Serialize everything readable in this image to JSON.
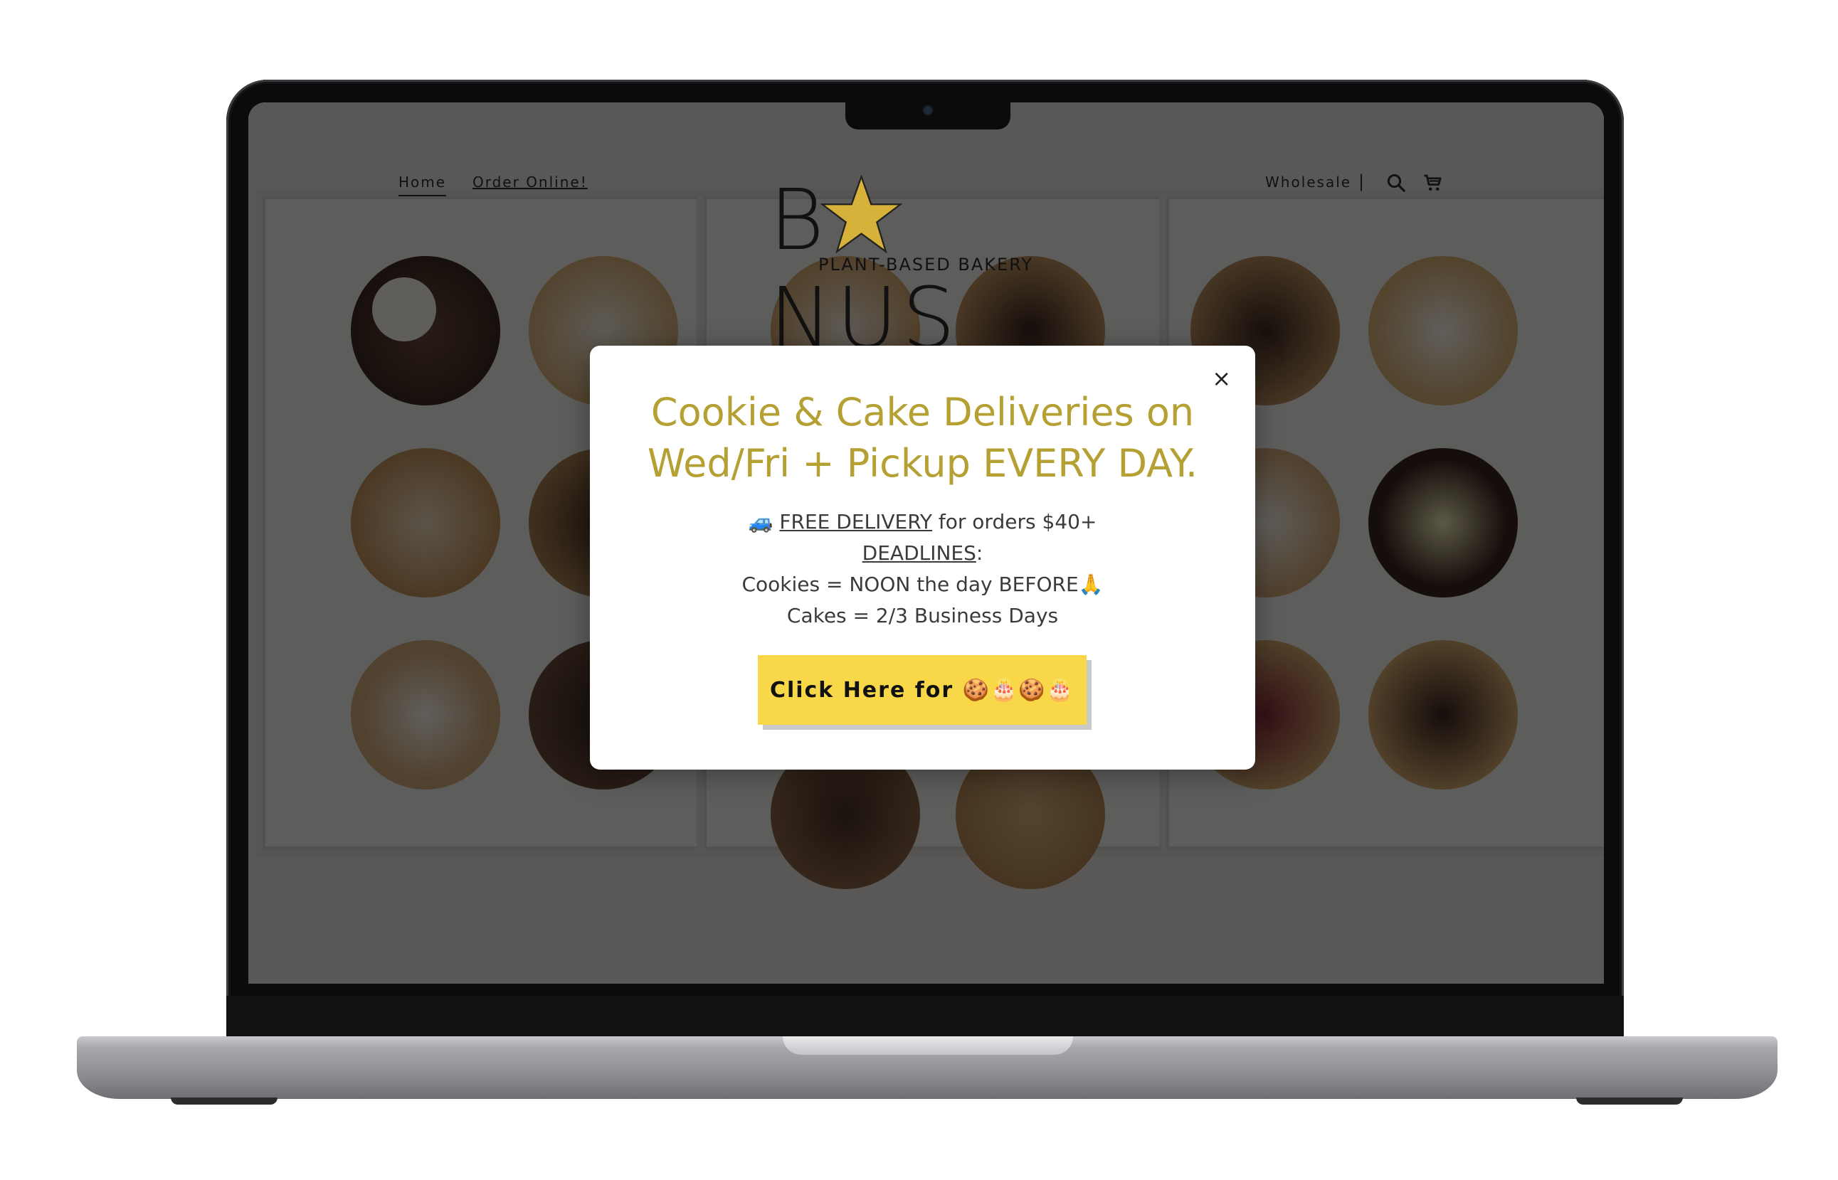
{
  "nav": {
    "home": "Home",
    "order_online": "Order Online!",
    "wholesale": "Wholesale",
    "divider": "|"
  },
  "logo": {
    "word_left": "B",
    "word_right": "NUS",
    "tagline": "PLANT-BASED BAKERY"
  },
  "modal": {
    "close": "×",
    "headline_line1": "Cookie & Cake Deliveries on",
    "headline_line2": "Wed/Fri + Pickup EVERY DAY.",
    "delivery_emoji": "🚙",
    "free_delivery": "FREE DELIVERY",
    "free_delivery_rest": " for orders $40+",
    "deadlines": "DEADLINES",
    "deadlines_colon": ":",
    "cookies_line": "Cookies = NOON the day BEFORE🙏",
    "cakes_line": "Cakes = 2/3 Business Days",
    "cta": "Click Here for 🍪🎂🍪🎂"
  },
  "colors": {
    "headline": "#b5a033",
    "cta_bg": "#f8d848",
    "overlay": "rgba(0,0,0,0.62)",
    "star": "#d6b23a"
  }
}
